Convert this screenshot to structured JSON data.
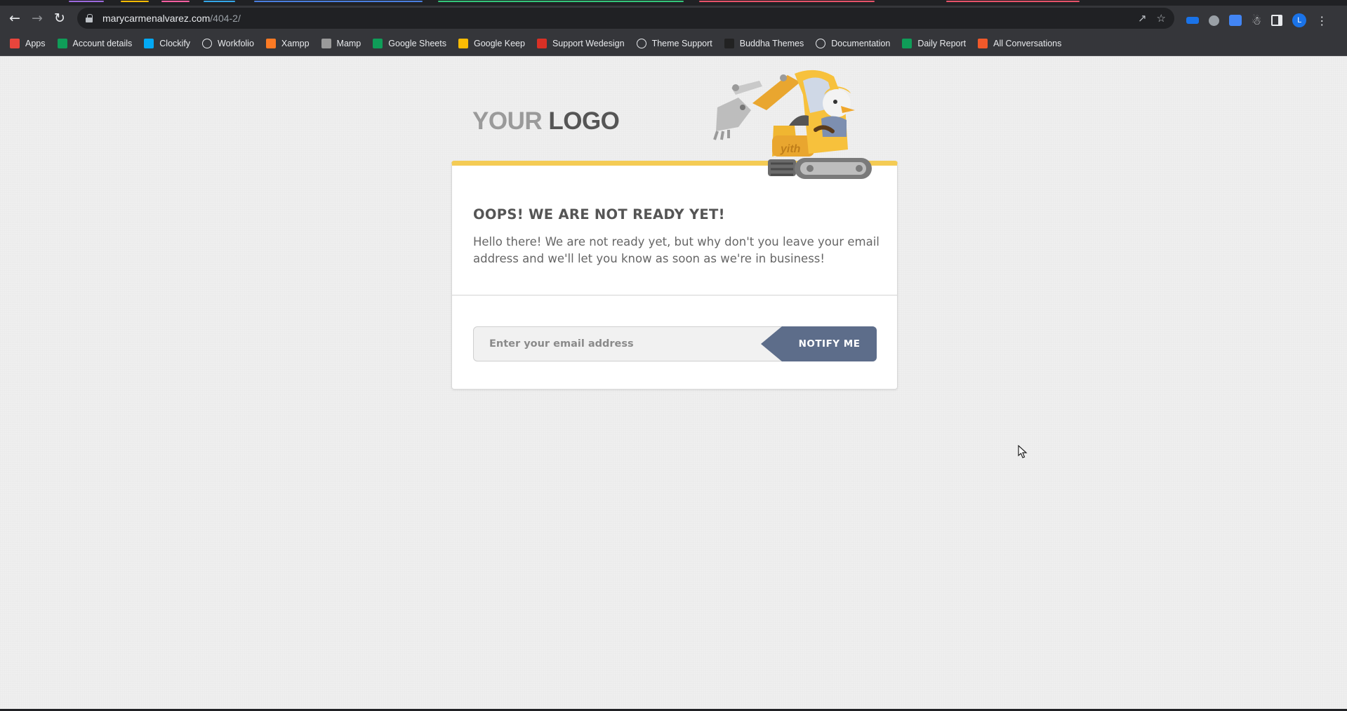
{
  "browser": {
    "url_host": "marycarmenalvarez.com",
    "url_path": "/404-2/",
    "profile_initial": "L"
  },
  "bookmarks": [
    {
      "label": "Apps",
      "icon": "apps-grid-icon",
      "color": "#e8453c"
    },
    {
      "label": "Account details",
      "icon": "sheets-icon",
      "color": "#0f9d58"
    },
    {
      "label": "Clockify",
      "icon": "clockify-icon",
      "color": "#03a9f4"
    },
    {
      "label": "Workfolio",
      "icon": "workfolio-icon",
      "color": "#ffffff"
    },
    {
      "label": "Xampp",
      "icon": "xampp-icon",
      "color": "#fb7a24"
    },
    {
      "label": "Mamp",
      "icon": "mamp-icon",
      "color": "#9a9a9a"
    },
    {
      "label": "Google Sheets",
      "icon": "sheets-icon",
      "color": "#0f9d58"
    },
    {
      "label": "Google Keep",
      "icon": "keep-icon",
      "color": "#fbbc04"
    },
    {
      "label": "Support Wedesign",
      "icon": "wedesign-icon",
      "color": "#d93025"
    },
    {
      "label": "Theme Support",
      "icon": "wordpress-icon",
      "color": "#ffffff"
    },
    {
      "label": "Buddha Themes",
      "icon": "buddha-icon",
      "color": "#222222"
    },
    {
      "label": "Documentation",
      "icon": "globe-icon",
      "color": "#ffffff"
    },
    {
      "label": "Daily Report",
      "icon": "sheets-icon",
      "color": "#0f9d58"
    },
    {
      "label": "All Conversations",
      "icon": "conversations-icon",
      "color": "#f1592a"
    }
  ],
  "page": {
    "logo_light": "YOUR",
    "logo_dark": "LOGO",
    "heading": "OOPS! WE ARE NOT READY YET!",
    "message": "Hello there! We are not ready yet, but why don't you leave your email address and we'll let you know as soon as we're in business!",
    "email_placeholder": "Enter your email address",
    "notify_label": "NOTIFY ME",
    "mascot_text": "yith"
  },
  "colors": {
    "accent": "#f4cb54",
    "button": "#5d6d8a"
  }
}
